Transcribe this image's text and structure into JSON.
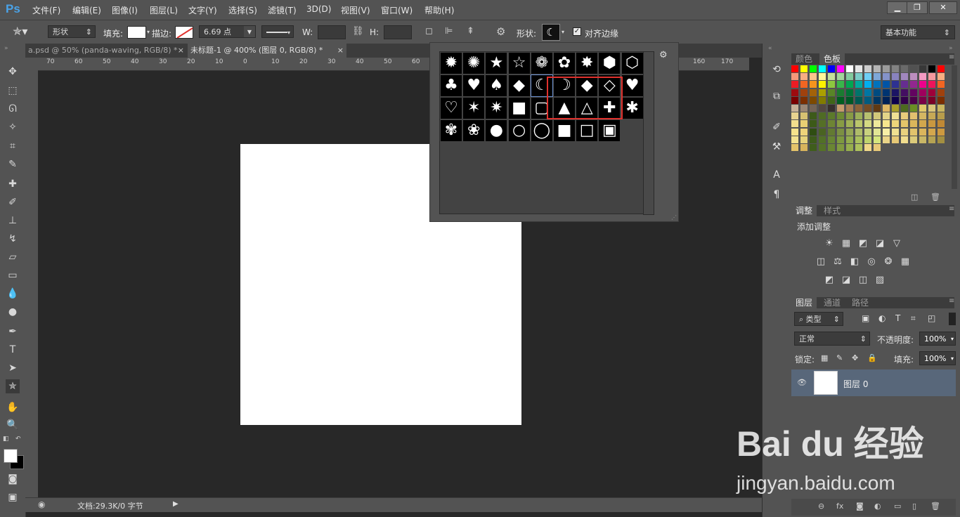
{
  "app": {
    "logo": "Ps"
  },
  "menu": {
    "items": [
      "文件(F)",
      "编辑(E)",
      "图像(I)",
      "图层(L)",
      "文字(Y)",
      "选择(S)",
      "滤镜(T)",
      "3D(D)",
      "视图(V)",
      "窗口(W)",
      "帮助(H)"
    ]
  },
  "window_controls": {
    "minimize": "▁",
    "restore": "❐",
    "close": "✕"
  },
  "options": {
    "mode_value": "形状",
    "fill_label": "填充:",
    "stroke_label": "描边:",
    "stroke_width": "6.69 点",
    "w_label": "W:",
    "h_label": "H:",
    "shape_label": "形状:",
    "align_edges": "对齐边缘",
    "workspace": "基本功能"
  },
  "tabs": [
    {
      "label": "a.psd @ 50% (panda-waving, RGB/8) *",
      "close": "×"
    },
    {
      "label": "未标题-1 @ 400% (图层 0, RGB/8) *",
      "close": "×"
    }
  ],
  "ruler": {
    "numbers": [
      "70",
      "60",
      "50",
      "40",
      "30",
      "20",
      "10",
      "0",
      "10",
      "20",
      "30",
      "40",
      "50",
      "60",
      "160",
      "170"
    ]
  },
  "status": {
    "doc_info": "文档:29.3K/0 字节"
  },
  "picker": {
    "shapes": [
      "✹",
      "✺",
      "★",
      "☆",
      "❁",
      "✿",
      "✸",
      "⬢",
      "⬡",
      "♣",
      "♥",
      "♠",
      "◆",
      "☾",
      "☽",
      "◆",
      "◇",
      "♥",
      "♡",
      "✶",
      "✷",
      "■",
      "▢",
      "▲",
      "△",
      "✚",
      "✱",
      "✾",
      "❀",
      "●",
      "○",
      "◯",
      "■",
      "□",
      "▣"
    ],
    "gear": "⚙"
  },
  "panels": {
    "color_tabs": [
      "颜色",
      "色板"
    ],
    "adjust_tabs": [
      "调整",
      "样式"
    ],
    "add_adjustment": "添加调整",
    "adjust_icons_row1": [
      "☀",
      "▦",
      "◩",
      "◪",
      "▽"
    ],
    "adjust_icons_row2": [
      "◫",
      "⚖",
      "◧",
      "◎",
      "❂",
      "▦"
    ],
    "adjust_icons_row3": [
      "◩",
      "◪",
      "◫",
      "▨"
    ],
    "layer_tabs": [
      "图层",
      "通道",
      "路径"
    ],
    "filter_label": "类型",
    "blend_mode": "正常",
    "opacity_label": "不透明度:",
    "opacity_value": "100%",
    "lock_label": "锁定:",
    "fill_label": "填充:",
    "fill_value": "100%",
    "layer_name": "图层 0",
    "footer_icons": [
      "⊖",
      "fx",
      "◙",
      "◐",
      "▭",
      "▯",
      "🗑"
    ]
  },
  "watermark": {
    "brand": "Bai du 经验",
    "url": "jingyan.baidu.com"
  },
  "colors": {
    "accent_highlight": "#e0312d"
  }
}
